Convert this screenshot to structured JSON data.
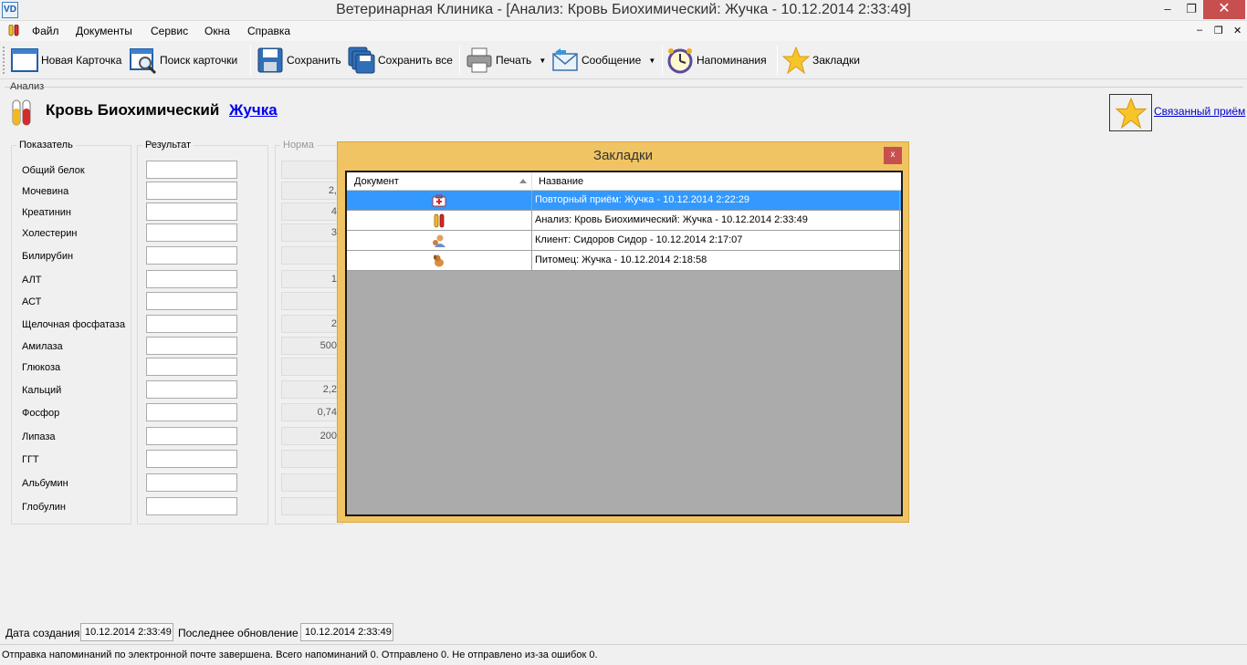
{
  "window": {
    "app_icon": "VD",
    "title": "Ветеринарная Клиника - [Анализ: Кровь Биохимический: Жучка - 10.12.2014 2:33:49]",
    "minimize": "–",
    "restore": "❐",
    "close": "✕"
  },
  "menu": {
    "items": [
      "Файл",
      "Документы",
      "Сервис",
      "Окна",
      "Справка"
    ],
    "mdi_min": "–",
    "mdi_restore": "❐",
    "mdi_close": "✕"
  },
  "toolbar": {
    "new_card": "Новая Карточка",
    "find_card": "Поиск карточки",
    "save": "Сохранить",
    "save_all": "Сохранить все",
    "print": "Печать",
    "message": "Сообщение",
    "reminders": "Напоминания",
    "bookmarks": "Закладки"
  },
  "analysis": {
    "group_label": "Анализ",
    "title": "Кровь Биохимический",
    "pet_link": "Жучка",
    "linked_visit": "Связанный приём",
    "col_indicator": "Показатель",
    "col_result": "Результат",
    "col_norm": "Норма",
    "rows": [
      {
        "label": "Общий белок",
        "norm": ""
      },
      {
        "label": "Мочевина",
        "norm": "2,"
      },
      {
        "label": "Креатинин",
        "norm": "4"
      },
      {
        "label": "Холестерин",
        "norm": "3"
      },
      {
        "label": "Билирубин",
        "norm": ""
      },
      {
        "label": "АЛТ",
        "norm": "1"
      },
      {
        "label": "АСТ",
        "norm": ""
      },
      {
        "label": "Щелочная фосфатаза",
        "norm": "2"
      },
      {
        "label": "Амилаза",
        "norm": "500"
      },
      {
        "label": "Глюкоза",
        "norm": ""
      },
      {
        "label": "Кальций",
        "norm": "2,2"
      },
      {
        "label": "Фосфор",
        "norm": "0,74"
      },
      {
        "label": "Липаза",
        "norm": "200"
      },
      {
        "label": "ГГТ",
        "norm": ""
      },
      {
        "label": "Альбумин",
        "norm": ""
      },
      {
        "label": "Глобулин",
        "norm": ""
      }
    ]
  },
  "bookmarks_dialog": {
    "title": "Закладки",
    "close": "x",
    "col_document": "Документ",
    "col_name": "Название",
    "rows": [
      {
        "icon": "medical-kit-icon",
        "name": "Повторный приём: Жучка - 10.12.2014 2:22:29",
        "selected": true
      },
      {
        "icon": "test-tubes-icon",
        "name": "Анализ: Кровь Биохимический: Жучка - 10.12.2014 2:33:49",
        "selected": false
      },
      {
        "icon": "client-icon",
        "name": "Клиент: Сидоров Сидор - 10.12.2014 2:17:07",
        "selected": false
      },
      {
        "icon": "pet-icon",
        "name": "Питомец: Жучка - 10.12.2014 2:18:58",
        "selected": false
      }
    ]
  },
  "footer": {
    "created_label": "Дата создания",
    "created_value": "10.12.2014 2:33:49",
    "updated_label": "Последнее обновление",
    "updated_value": "10.12.2014 2:33:49"
  },
  "status": "Отправка напоминаний по электронной почте завершена. Всего напоминаний 0. Отправлено 0. Не отправлено из-за ошибок 0."
}
